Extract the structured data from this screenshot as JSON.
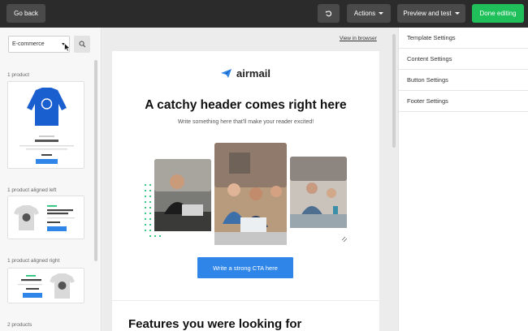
{
  "topbar": {
    "back_label": "Go back",
    "actions_label": "Actions",
    "preview_label": "Preview and test",
    "done_label": "Done editing",
    "undo_icon": "undo-icon"
  },
  "left": {
    "category_value": "E-commerce",
    "sections": [
      {
        "label": "1 product"
      },
      {
        "label": "1 product aligned left"
      },
      {
        "label": "1 product aligned right"
      },
      {
        "label": "2 products"
      }
    ]
  },
  "center": {
    "view_in_browser": "View in browser",
    "logo_text": "airmail",
    "headline": "A catchy header comes right here",
    "subline": "Write something here that'll make your reader excited!",
    "cta_label": "Write a strong CTA here",
    "features_heading": "Features you were looking for"
  },
  "right": {
    "items": [
      {
        "label": "Template Settings"
      },
      {
        "label": "Content Settings"
      },
      {
        "label": "Button Settings"
      },
      {
        "label": "Footer Settings"
      }
    ]
  },
  "colors": {
    "topbar": "#2b2b2b",
    "done": "#1fbf5a",
    "cta": "#2f86e8",
    "accent_green": "#27c27a"
  }
}
